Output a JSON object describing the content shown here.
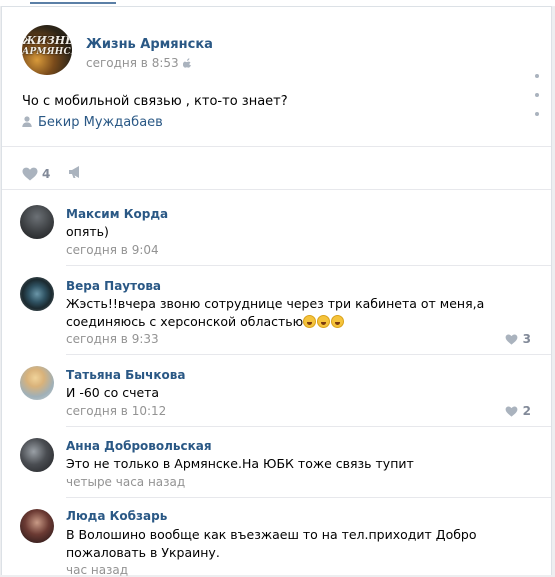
{
  "post": {
    "group_name": "Жизнь Армянска",
    "avatar_text_1": "ЖИЗНЬ",
    "avatar_text_2": "АРМЯНСКА",
    "time": "сегодня в 8:53",
    "text": "Чо с мобильной связью , кто-то знает?",
    "author": "Бекир Муждабаев",
    "likes": "4"
  },
  "comments": [
    {
      "name": "Максим Корда",
      "text": "опять)",
      "time": "сегодня в 9:04",
      "likes": ""
    },
    {
      "name": "Вера Паутова",
      "text": "Жэсть!!вчера звоню сотруднице через три кабинета от меня,а соединяюсь с херсонской областью",
      "time": "сегодня в 9:33",
      "likes": "3"
    },
    {
      "name": "Татьяна Бычкова",
      "text": "И -60 со счета",
      "time": "сегодня в 10:12",
      "likes": "2"
    },
    {
      "name": "Анна Добровольская",
      "text": "Это не только в Армянске.На ЮБК тоже связь тупит",
      "time": "четыре часа назад",
      "likes": ""
    },
    {
      "name": "Люда Кобзарь",
      "text": "В Волошино вообще как въезжаеш то на тел.приходит Добро пожаловать в Украину.",
      "time": "час назад",
      "likes": ""
    }
  ],
  "colors": {
    "link": "#2a5885",
    "meta": "#939393",
    "icon": "#aab3be",
    "background": "#edeef0"
  },
  "icons": {
    "like": "heart-icon",
    "share": "megaphone-icon",
    "more": "more-dots-icon",
    "author": "person-icon",
    "platform": "apple-icon"
  }
}
